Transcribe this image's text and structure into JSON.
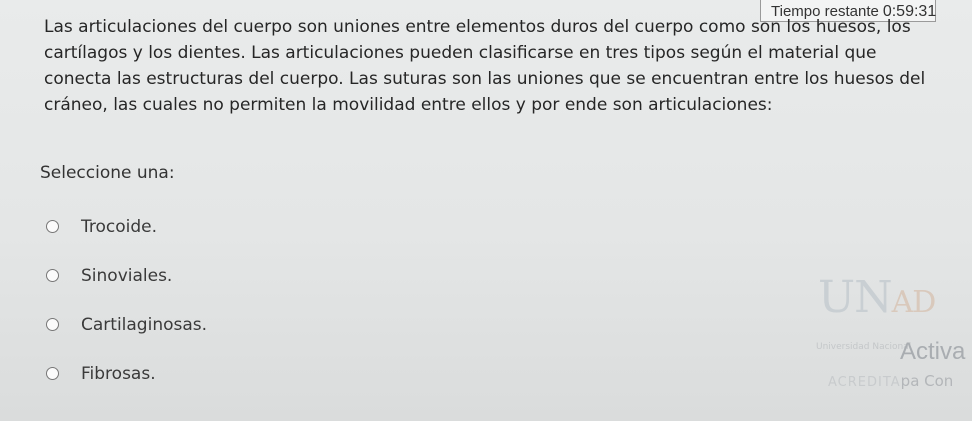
{
  "timer": {
    "label": "Tiempo restante",
    "value": "0:59:31"
  },
  "question": {
    "text": "Las articulaciones del cuerpo son uniones entre elementos duros del cuerpo como son los huesos, los cartílagos y los dientes. Las articulaciones pueden clasificarse en tres tipos según el material que conecta las estructuras del cuerpo. Las suturas son las uniones que se encuentran entre los huesos del cráneo, las cuales no permiten la movilidad entre ellos y por ende son articulaciones:"
  },
  "prompt": "Seleccione una:",
  "options": [
    {
      "label": "Trocoide."
    },
    {
      "label": "Sinoviales."
    },
    {
      "label": "Cartilaginosas."
    },
    {
      "label": "Fibrosas."
    }
  ],
  "watermark": {
    "logo_text": "UN",
    "logo_text_accent": "AD",
    "university": "Universidad Nacional",
    "activate": "Activa",
    "accredit": "ACREDITA",
    "accredit_tail": "pa Con"
  }
}
